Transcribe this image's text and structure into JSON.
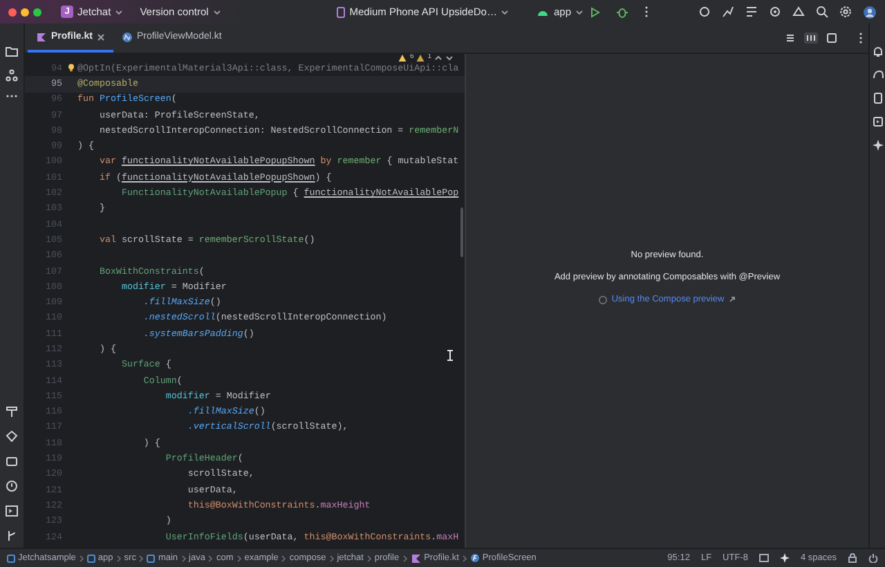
{
  "title_bar": {
    "project_initial": "J",
    "project": "Jetchat",
    "vcs": "Version control",
    "device": "Medium Phone API UpsideDo…",
    "run_config": "app"
  },
  "tabs": [
    {
      "label": "Profile.kt",
      "kind": "kotlin-file",
      "selected": true,
      "closable": true
    },
    {
      "label": "ProfileViewModel.kt",
      "kind": "kotlin-class",
      "selected": false,
      "closable": false
    }
  ],
  "inspections": {
    "warnings": "6",
    "weak_warnings": "1"
  },
  "editor": {
    "lines": [
      {
        "number": "94",
        "current": false,
        "tokens": [
          {
            "text": "@OptIn(ExperimentalMaterial3Api::class, ExperimentalComposeUiApi::cla",
            "kind": "muted"
          }
        ]
      },
      {
        "number": "95",
        "current": true,
        "tokens": [
          {
            "text": "@Composable",
            "kind": "annotation"
          }
        ]
      },
      {
        "number": "96",
        "current": false,
        "tokens": [
          {
            "text": "fun ",
            "kind": "keyword"
          },
          {
            "text": "ProfileScreen",
            "kind": "decl"
          },
          {
            "text": "(",
            "kind": "plain"
          }
        ]
      },
      {
        "number": "97",
        "current": false,
        "tokens": [
          {
            "text": "    userData: ProfileScreenState,",
            "kind": "plain"
          }
        ]
      },
      {
        "number": "98",
        "current": false,
        "tokens": [
          {
            "text": "    nestedScrollInteropConnection: NestedScrollConnection = ",
            "kind": "plain"
          },
          {
            "text": "rememberN",
            "kind": "call"
          }
        ]
      },
      {
        "number": "99",
        "current": false,
        "tokens": [
          {
            "text": ") {",
            "kind": "plain"
          }
        ]
      },
      {
        "number": "100",
        "current": false,
        "tokens": [
          {
            "text": "    var ",
            "kind": "keyword"
          },
          {
            "text": "functionalityNotAvailablePopupShown",
            "kind": "variable"
          },
          {
            "text": " by ",
            "kind": "keyword"
          },
          {
            "text": "remember",
            "kind": "call"
          },
          {
            "text": " { mutableStat",
            "kind": "plain"
          }
        ]
      },
      {
        "number": "101",
        "current": false,
        "tokens": [
          {
            "text": "    if",
            "kind": "keyword"
          },
          {
            "text": " (",
            "kind": "plain"
          },
          {
            "text": "functionalityNotAvailablePopupShown",
            "kind": "variable"
          },
          {
            "text": ") {",
            "kind": "plain"
          }
        ]
      },
      {
        "number": "102",
        "current": false,
        "tokens": [
          {
            "text": "        FunctionalityNotAvailablePopup",
            "kind": "composable"
          },
          {
            "text": " { ",
            "kind": "plain"
          },
          {
            "text": "functionalityNotAvailablePop",
            "kind": "variable"
          }
        ]
      },
      {
        "number": "103",
        "current": false,
        "tokens": [
          {
            "text": "    }",
            "kind": "plain"
          }
        ]
      },
      {
        "number": "104",
        "current": false
      },
      {
        "number": "105",
        "current": false,
        "tokens": [
          {
            "text": "    val",
            "kind": "keyword"
          },
          {
            "text": " scrollState = ",
            "kind": "plain"
          },
          {
            "text": "rememberScrollState",
            "kind": "call"
          },
          {
            "text": "()",
            "kind": "plain"
          }
        ]
      },
      {
        "number": "106",
        "current": false
      },
      {
        "number": "107",
        "current": false,
        "tokens": [
          {
            "text": "    BoxWithConstraints",
            "kind": "composable"
          },
          {
            "text": "(",
            "kind": "plain"
          }
        ]
      },
      {
        "number": "108",
        "current": false,
        "tokens": [
          {
            "text": "        modifier",
            "kind": "named-arg"
          },
          {
            "text": " = Modifier",
            "kind": "plain"
          }
        ]
      },
      {
        "number": "109",
        "current": false,
        "tokens": [
          {
            "text": "            .fillMaxSize",
            "kind": "extension"
          },
          {
            "text": "()",
            "kind": "plain"
          }
        ]
      },
      {
        "number": "110",
        "current": false,
        "tokens": [
          {
            "text": "            .nestedScroll",
            "kind": "extension"
          },
          {
            "text": "(nestedScrollInteropConnection)",
            "kind": "plain"
          }
        ]
      },
      {
        "number": "111",
        "current": false,
        "tokens": [
          {
            "text": "            .systemBarsPadding",
            "kind": "extension"
          },
          {
            "text": "()",
            "kind": "plain"
          }
        ]
      },
      {
        "number": "112",
        "current": false,
        "tokens": [
          {
            "text": "    ) {",
            "kind": "plain"
          }
        ]
      },
      {
        "number": "113",
        "current": false,
        "tokens": [
          {
            "text": "        Surface",
            "kind": "composable"
          },
          {
            "text": " {",
            "kind": "plain"
          }
        ]
      },
      {
        "number": "114",
        "current": false,
        "tokens": [
          {
            "text": "            Column",
            "kind": "composable"
          },
          {
            "text": "(",
            "kind": "plain"
          }
        ]
      },
      {
        "number": "115",
        "current": false,
        "tokens": [
          {
            "text": "                modifier",
            "kind": "named-arg"
          },
          {
            "text": " = Modifier",
            "kind": "plain"
          }
        ]
      },
      {
        "number": "116",
        "current": false,
        "tokens": [
          {
            "text": "                    .fillMaxSize",
            "kind": "extension"
          },
          {
            "text": "()",
            "kind": "plain"
          }
        ]
      },
      {
        "number": "117",
        "current": false,
        "tokens": [
          {
            "text": "                    .verticalScroll",
            "kind": "extension"
          },
          {
            "text": "(scrollState),",
            "kind": "plain"
          }
        ]
      },
      {
        "number": "118",
        "current": false,
        "tokens": [
          {
            "text": "            ) {",
            "kind": "plain"
          }
        ]
      },
      {
        "number": "119",
        "current": false,
        "tokens": [
          {
            "text": "                ProfileHeader",
            "kind": "composable"
          },
          {
            "text": "(",
            "kind": "plain"
          }
        ]
      },
      {
        "number": "120",
        "current": false,
        "tokens": [
          {
            "text": "                    scrollState,",
            "kind": "plain"
          }
        ]
      },
      {
        "number": "121",
        "current": false,
        "tokens": [
          {
            "text": "                    userData,",
            "kind": "plain"
          }
        ]
      },
      {
        "number": "122",
        "current": false,
        "tokens": [
          {
            "text": "                    this@BoxWithConstraints",
            "kind": "keyword"
          },
          {
            "text": ".",
            "kind": "plain"
          },
          {
            "text": "maxHeight",
            "kind": "property"
          }
        ]
      },
      {
        "number": "123",
        "current": false,
        "tokens": [
          {
            "text": "                )",
            "kind": "plain"
          }
        ]
      },
      {
        "number": "124",
        "current": false,
        "tokens": [
          {
            "text": "                UserInfoFields",
            "kind": "composable"
          },
          {
            "text": "(userData, ",
            "kind": "plain"
          },
          {
            "text": "this@BoxWithConstraints",
            "kind": "keyword"
          },
          {
            "text": ".",
            "kind": "plain"
          },
          {
            "text": "maxH",
            "kind": "property"
          }
        ]
      }
    ]
  },
  "preview": {
    "message": "No preview found.",
    "hint": "Add preview by annotating Composables with @Preview",
    "link": "Using the Compose preview"
  },
  "status_bar": {
    "breadcrumbs": [
      {
        "label": "Jetchatsample",
        "kind": "module"
      },
      {
        "label": "app",
        "kind": "module"
      },
      {
        "label": "src",
        "kind": "plain"
      },
      {
        "label": "main",
        "kind": "module"
      },
      {
        "label": "java",
        "kind": "plain"
      },
      {
        "label": "com",
        "kind": "plain"
      },
      {
        "label": "example",
        "kind": "plain"
      },
      {
        "label": "compose",
        "kind": "plain"
      },
      {
        "label": "jetchat",
        "kind": "plain"
      },
      {
        "label": "profile",
        "kind": "plain"
      },
      {
        "label": "Profile.kt",
        "kind": "kotlin-file"
      },
      {
        "label": "ProfileScreen",
        "kind": "function"
      }
    ],
    "position": "95:12",
    "line_separator": "LF",
    "encoding": "UTF-8",
    "indent": "4 spaces"
  }
}
